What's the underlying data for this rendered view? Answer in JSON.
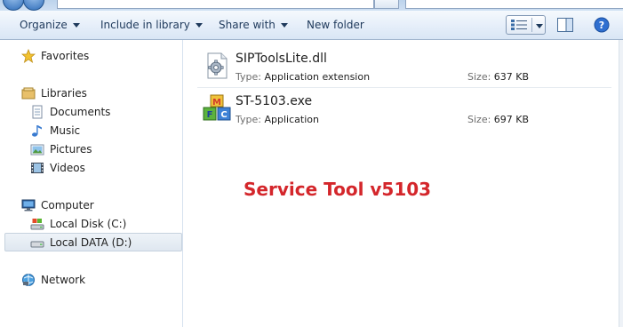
{
  "toolbar": {
    "organize_label": "Organize",
    "include_label": "Include in library",
    "share_label": "Share with",
    "new_folder_label": "New folder"
  },
  "nav": {
    "favorites": "Favorites",
    "libraries": "Libraries",
    "documents": "Documents",
    "music": "Music",
    "pictures": "Pictures",
    "videos": "Videos",
    "computer": "Computer",
    "local_disk_c": "Local Disk (C:)",
    "local_data_d": "Local DATA (D:)",
    "network": "Network",
    "selected_item": "Local DATA (D:)"
  },
  "files": [
    {
      "name": "SIPToolsLite.dll",
      "type_key": "Type:",
      "type_value": "Application extension",
      "size_key": "Size:",
      "size_value": "637 KB",
      "icon": "dll-gear-icon"
    },
    {
      "name": "ST-5103.exe",
      "type_key": "Type:",
      "type_value": "Application",
      "size_key": "Size:",
      "size_value": "697 KB",
      "icon": "mfc-blocks-icon"
    }
  ],
  "overlay": {
    "caption": "Service Tool v5103",
    "color": "#d4262b"
  },
  "colors": {
    "command_bar_text": "#1e395b",
    "nav_selected_bg": "#e6edf5"
  }
}
